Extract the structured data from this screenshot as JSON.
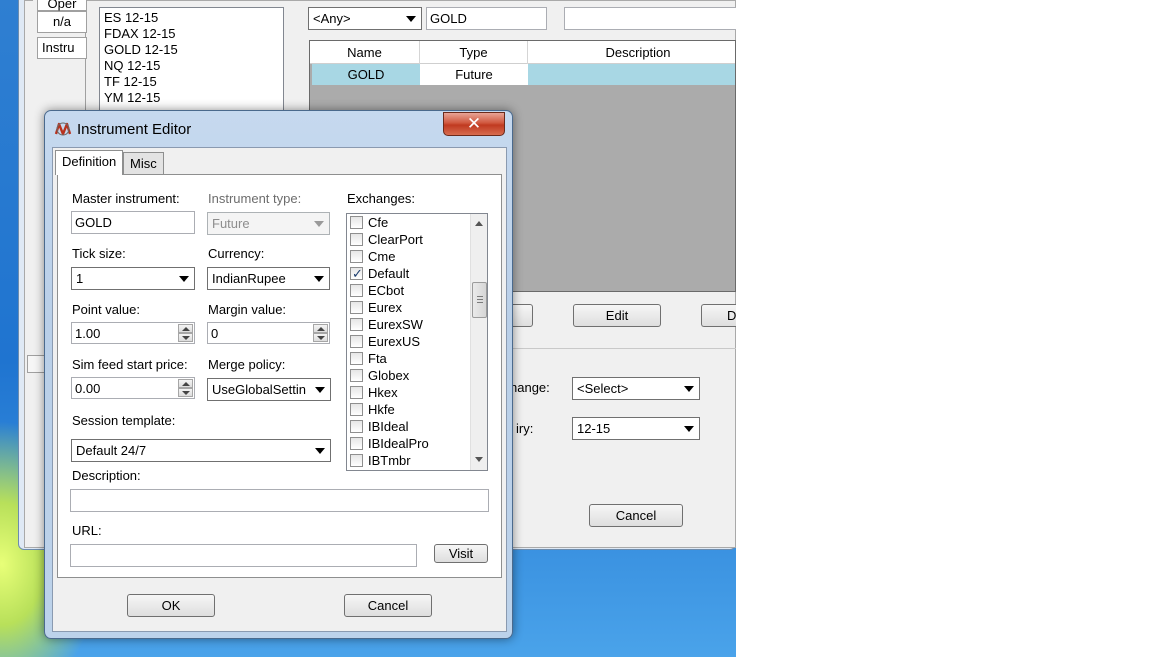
{
  "background_window": {
    "left_column": {
      "header": "Oper",
      "value": "n/a",
      "label": "Instru"
    },
    "instrument_list": [
      "ES 12-15",
      "FDAX 12-15",
      "GOLD 12-15",
      "NQ 12-15",
      "TF 12-15",
      "YM 12-15"
    ],
    "type_filter": "<Any>",
    "search_text": "GOLD",
    "grid": {
      "columns": [
        "Name",
        "Type",
        "Description"
      ],
      "rows": [
        {
          "name": "GOLD",
          "type": "Future",
          "description": ""
        }
      ]
    },
    "buttons": {
      "edit": "Edit",
      "delete_partial": "D",
      "cancel": "Cancel"
    },
    "exchange_label_partial": "hange:",
    "exchange_value": "<Select>",
    "expiry_label_partial": "iry:",
    "expiry_value": "12-15"
  },
  "dialog": {
    "title": "Instrument Editor",
    "close_glyph": "✕",
    "tabs": [
      "Definition",
      "Misc"
    ],
    "master_instrument": {
      "label": "Master instrument:",
      "value": "GOLD"
    },
    "instrument_type": {
      "label": "Instrument type:",
      "value": "Future"
    },
    "tick_size": {
      "label": "Tick size:",
      "value": "1"
    },
    "currency": {
      "label": "Currency:",
      "value": "IndianRupee"
    },
    "point_value": {
      "label": "Point value:",
      "value": "1.00"
    },
    "margin_value": {
      "label": "Margin value:",
      "value": "0"
    },
    "sim_feed": {
      "label": "Sim feed start price:",
      "value": "0.00"
    },
    "merge_policy": {
      "label": "Merge policy:",
      "value": "UseGlobalSettin"
    },
    "session_template": {
      "label": "Session template:",
      "value": "Default 24/7"
    },
    "description": {
      "label": "Description:",
      "value": ""
    },
    "url": {
      "label": "URL:",
      "value": "",
      "visit": "Visit"
    },
    "exchanges": {
      "label": "Exchanges:",
      "items": [
        {
          "name": "Cfe",
          "checked": false
        },
        {
          "name": "ClearPort",
          "checked": false
        },
        {
          "name": "Cme",
          "checked": false
        },
        {
          "name": "Default",
          "checked": true
        },
        {
          "name": "ECbot",
          "checked": false
        },
        {
          "name": "Eurex",
          "checked": false
        },
        {
          "name": "EurexSW",
          "checked": false
        },
        {
          "name": "EurexUS",
          "checked": false
        },
        {
          "name": "Fta",
          "checked": false
        },
        {
          "name": "Globex",
          "checked": false
        },
        {
          "name": "Hkex",
          "checked": false
        },
        {
          "name": "Hkfe",
          "checked": false
        },
        {
          "name": "IBIdeal",
          "checked": false
        },
        {
          "name": "IBIdealPro",
          "checked": false
        },
        {
          "name": "IBTmbr",
          "checked": false
        }
      ]
    },
    "ok": "OK",
    "cancel": "Cancel"
  }
}
